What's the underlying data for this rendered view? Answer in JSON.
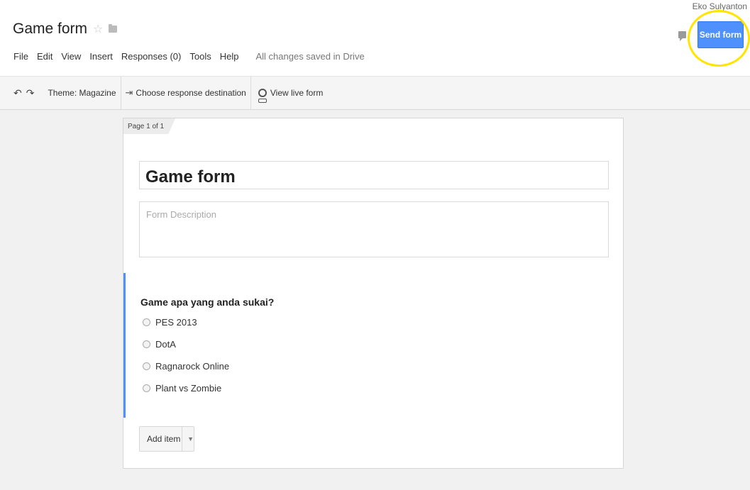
{
  "header": {
    "username": "Eko Sulyanton",
    "doc_title": "Game form",
    "star_icon": "☆",
    "menu": [
      "File",
      "Edit",
      "View",
      "Insert",
      "Responses (0)",
      "Tools",
      "Help"
    ],
    "save_status": "All changes saved in Drive",
    "send_button": "Send form"
  },
  "toolbar": {
    "undo_icon": "↶",
    "redo_icon": "↷",
    "theme": "Theme: Magazine",
    "response_destination": "Choose response destination",
    "view_live": "View live form"
  },
  "form": {
    "page_label": "Page 1 of 1",
    "title": "Game form",
    "description_placeholder": "Form Description",
    "question": {
      "title": "Game apa yang anda sukai?",
      "options": [
        "PES 2013",
        "DotA",
        "Ragnarock Online",
        "Plant vs Zombie"
      ]
    },
    "add_item_label": "Add item"
  },
  "colors": {
    "accent": "#4d90fe",
    "highlight_ring": "#ffe500"
  }
}
